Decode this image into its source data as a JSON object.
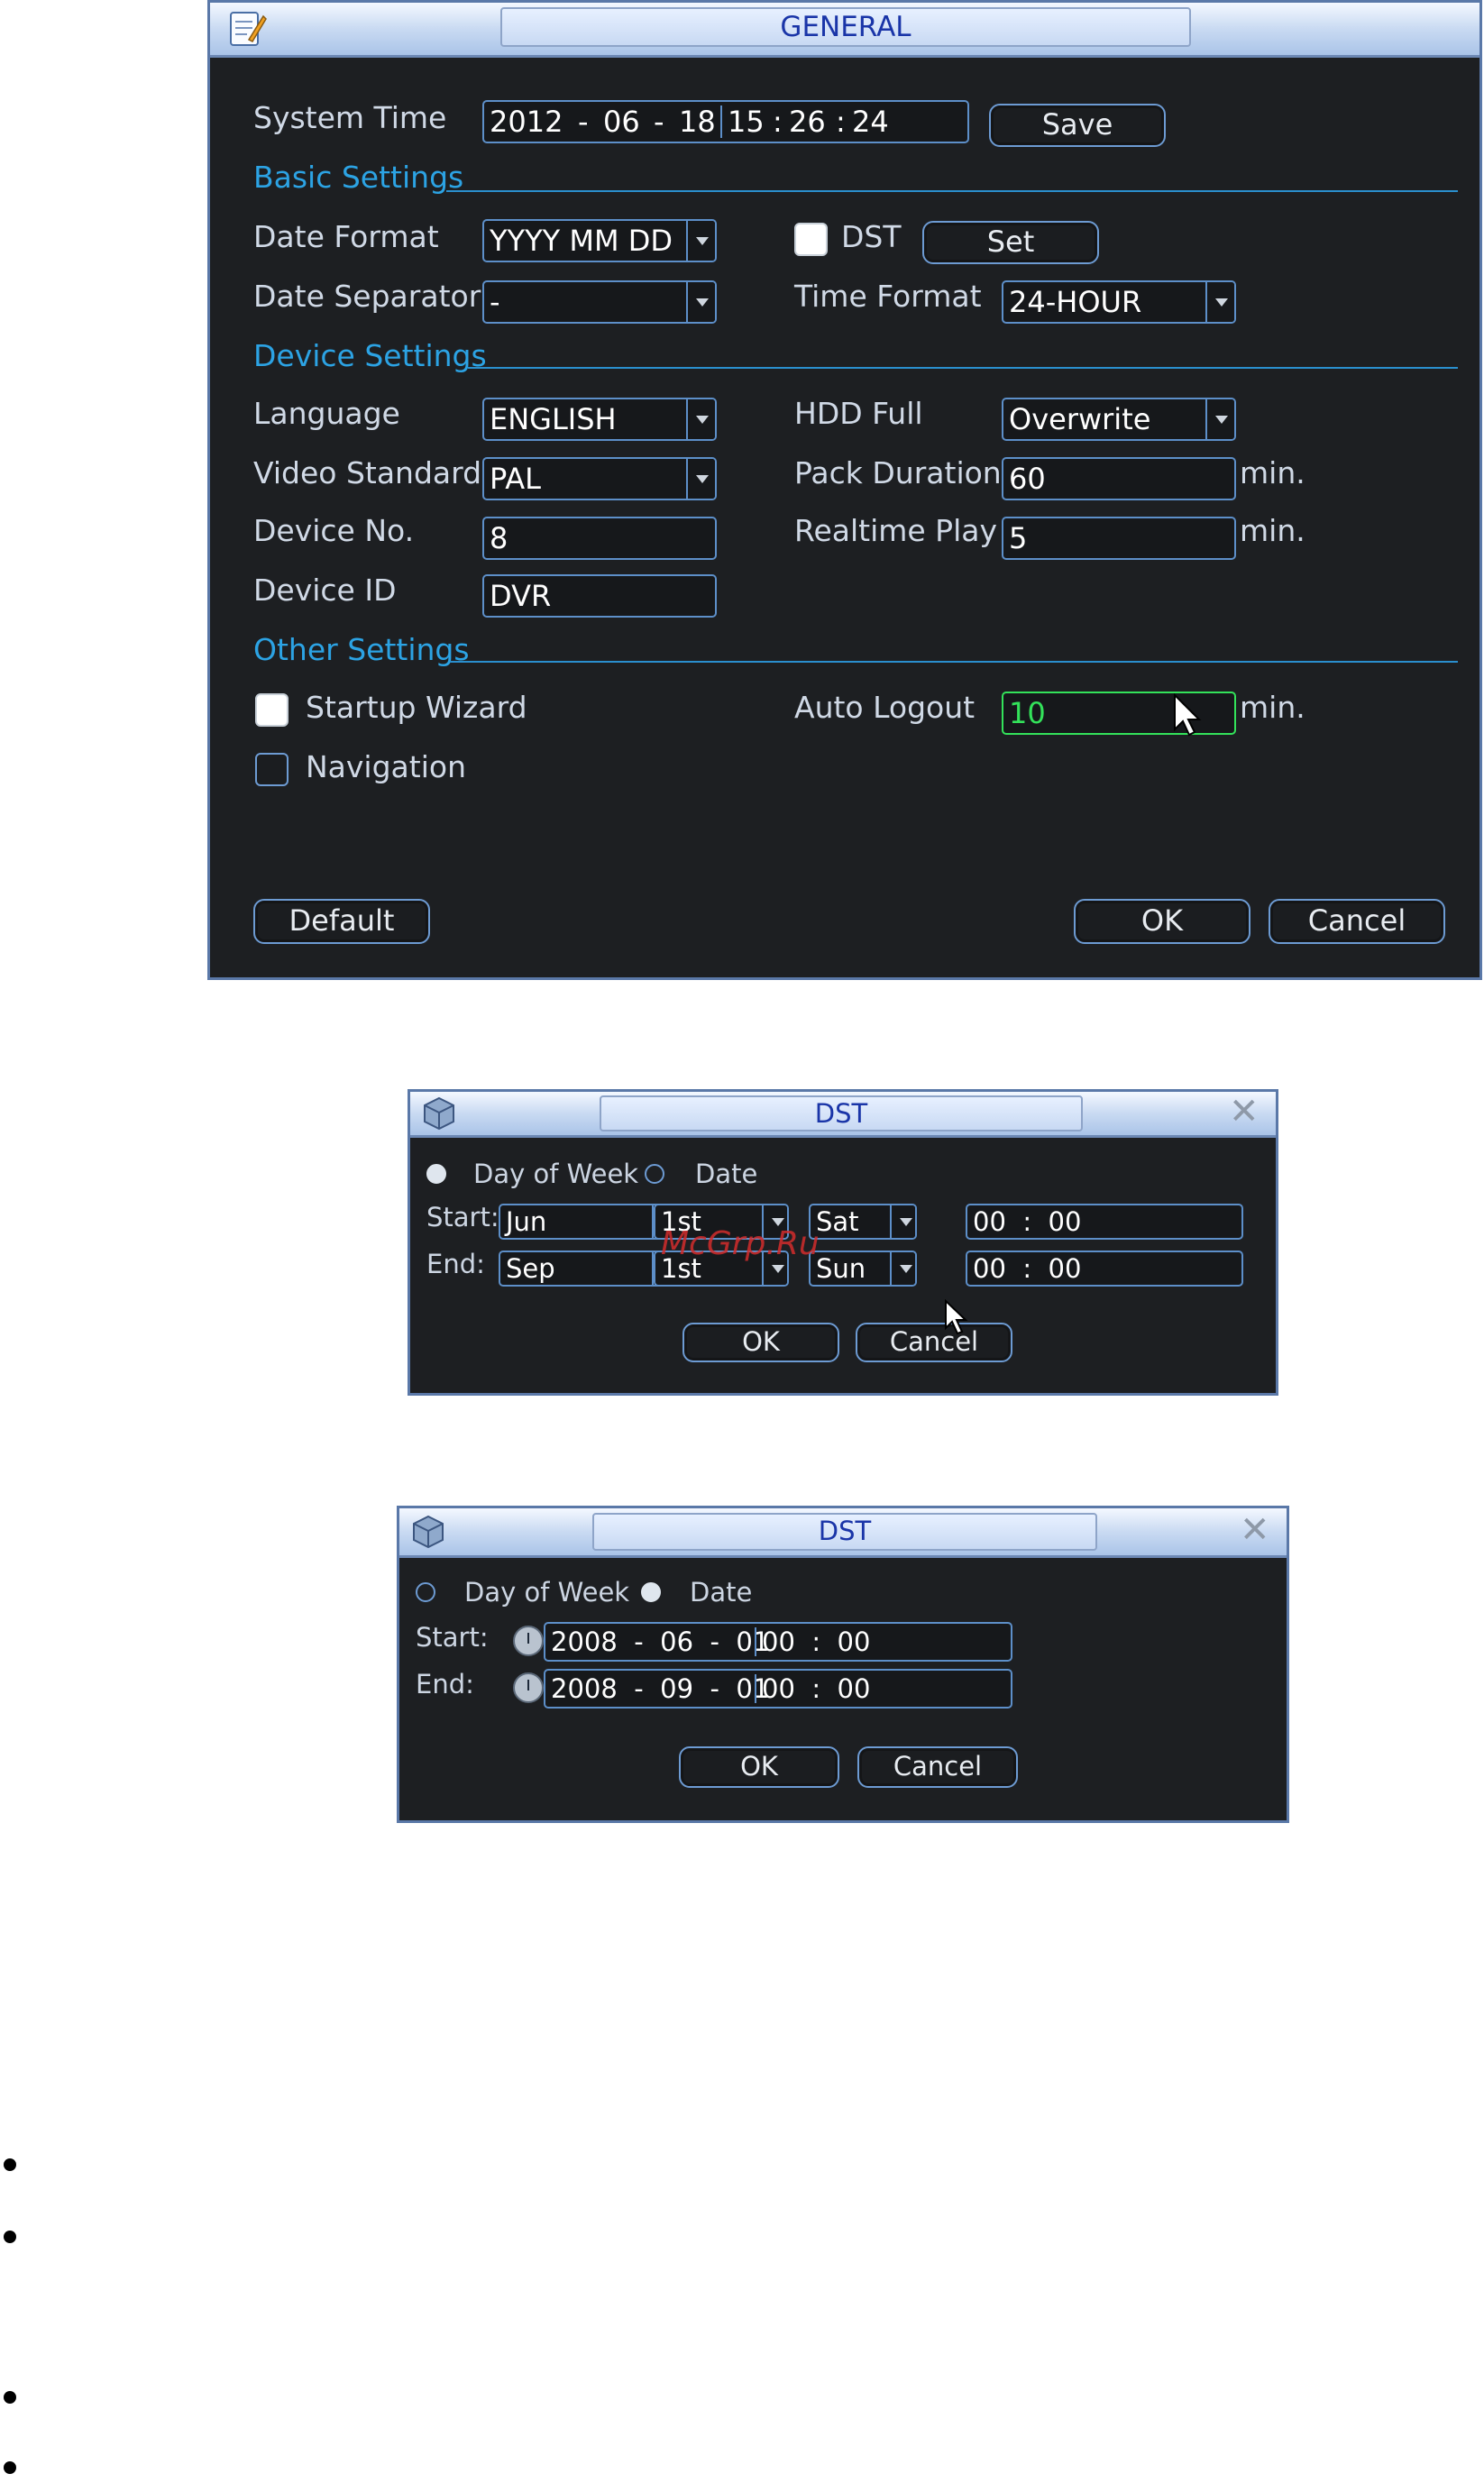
{
  "general": {
    "title": "GENERAL",
    "system_time": {
      "label": "System Time",
      "year": "2012",
      "month": "06",
      "day": "18",
      "hour": "15",
      "minute": "26",
      "second": "24",
      "save_label": "Save"
    },
    "basic_settings": {
      "heading": "Basic Settings",
      "date_format_label": "Date Format",
      "date_format_value": "YYYY MM DD",
      "dst_label": "DST",
      "dst_checked": true,
      "set_label": "Set",
      "date_separator_label": "Date Separator",
      "date_separator_value": "-",
      "time_format_label": "Time Format",
      "time_format_value": "24-HOUR"
    },
    "device_settings": {
      "heading": "Device Settings",
      "language_label": "Language",
      "language_value": "ENGLISH",
      "hdd_full_label": "HDD Full",
      "hdd_full_value": "Overwrite",
      "video_standard_label": "Video Standard",
      "video_standard_value": "PAL",
      "pack_duration_label": "Pack Duration",
      "pack_duration_value": "60",
      "device_no_label": "Device No.",
      "device_no_value": "8",
      "realtime_play_label": "Realtime Play",
      "realtime_play_value": "5",
      "device_id_label": "Device ID",
      "device_id_value": "DVR",
      "unit": "min."
    },
    "other_settings": {
      "heading": "Other Settings",
      "startup_wizard_label": "Startup Wizard",
      "startup_wizard_checked": true,
      "navigation_label": "Navigation",
      "navigation_checked": false,
      "auto_logout_label": "Auto Logout",
      "auto_logout_value": "10"
    },
    "buttons": {
      "default": "Default",
      "ok": "OK",
      "cancel": "Cancel"
    }
  },
  "dst_week": {
    "title": "DST",
    "mode_week_label": "Day of Week",
    "mode_date_label": "Date",
    "selected": "week",
    "start_label": "Start:",
    "end_label": "End:",
    "start": {
      "month": "Jun",
      "week": "1st",
      "day": "Sat",
      "time": "00  :  00"
    },
    "end": {
      "month": "Sep",
      "week": "1st",
      "day": "Sun",
      "time": "00  :  00"
    },
    "ok": "OK",
    "cancel": "Cancel",
    "watermark": "McGrp.Ru"
  },
  "dst_date": {
    "title": "DST",
    "mode_week_label": "Day of Week",
    "mode_date_label": "Date",
    "selected": "date",
    "start_label": "Start:",
    "end_label": "End:",
    "start": {
      "date": "2008  -  06  -  01",
      "time": "00  :  00"
    },
    "end": {
      "date": "2008  -  09  -  01",
      "time": "00  :  00"
    },
    "ok": "OK",
    "cancel": "Cancel"
  },
  "icons": {
    "general_window": "settings-document-icon",
    "dst_window": "dst-cube-icon",
    "close": "close-icon",
    "clock": "clock-icon",
    "cursor": "mouse-pointer-icon"
  },
  "colors": {
    "window_bg": "#1d1f22",
    "section_heading": "#2ca3e4",
    "field_border": "#5d8fc9",
    "title_text": "#1a35a8",
    "focus_green": "#33e25a"
  }
}
